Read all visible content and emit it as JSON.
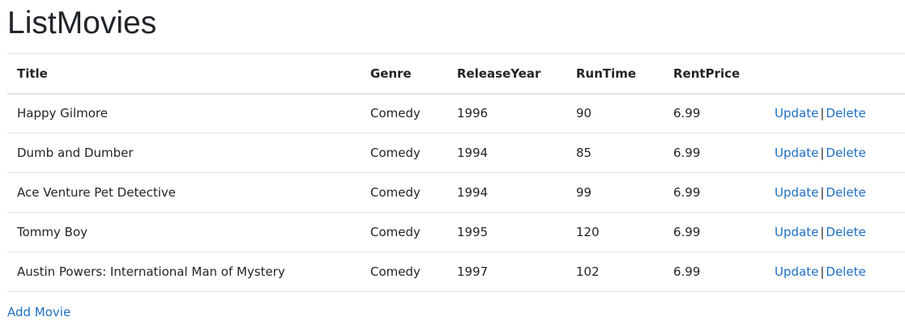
{
  "page": {
    "title": "ListMovies"
  },
  "table": {
    "columns": [
      "Title",
      "Genre",
      "ReleaseYear",
      "RunTime",
      "RentPrice",
      ""
    ],
    "rows": [
      {
        "title": "Happy Gilmore",
        "genre": "Comedy",
        "release_year": "1996",
        "run_time": "90",
        "rent_price": "6.99"
      },
      {
        "title": "Dumb and Dumber",
        "genre": "Comedy",
        "release_year": "1994",
        "run_time": "85",
        "rent_price": "6.99"
      },
      {
        "title": "Ace Venture Pet Detective",
        "genre": "Comedy",
        "release_year": "1994",
        "run_time": "99",
        "rent_price": "6.99"
      },
      {
        "title": "Tommy Boy",
        "genre": "Comedy",
        "release_year": "1995",
        "run_time": "120",
        "rent_price": "6.99"
      },
      {
        "title": "Austin Powers: International Man of Mystery",
        "genre": "Comedy",
        "release_year": "1997",
        "run_time": "102",
        "rent_price": "6.99"
      }
    ],
    "update_label": "Update",
    "delete_label": "Delete",
    "separator": "|"
  },
  "actions": {
    "add_movie_label": "Add Movie"
  },
  "colors": {
    "link": "#1e6fc4",
    "text": "#212529",
    "border": "#dee2e6"
  }
}
